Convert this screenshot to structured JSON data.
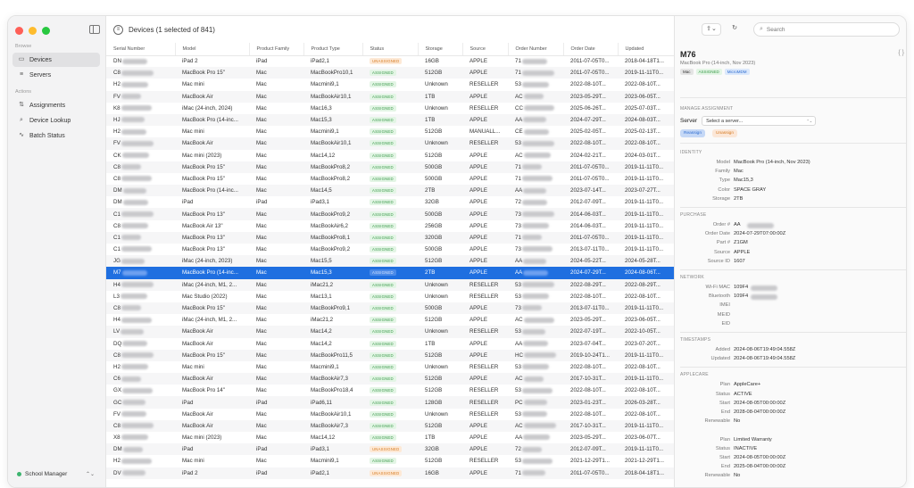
{
  "sidebar": {
    "browse_label": "Browse",
    "items_browse": [
      {
        "label": "Devices",
        "icon": "desktop-icon",
        "active": true
      },
      {
        "label": "Servers",
        "icon": "server-icon",
        "active": false
      }
    ],
    "actions_label": "Actions",
    "items_actions": [
      {
        "label": "Assignments",
        "icon": "sliders-icon"
      },
      {
        "label": "Device Lookup",
        "icon": "search-icon"
      },
      {
        "label": "Batch Status",
        "icon": "pulse-icon"
      }
    ],
    "org": "School Manager"
  },
  "toolbar": {
    "title": "Devices (1 selected of 841)"
  },
  "table": {
    "columns": [
      "Serial Number",
      "Model",
      "Product Family",
      "Product Type",
      "Status",
      "Storage",
      "Source",
      "Order Number",
      "Order Date",
      "Updated"
    ],
    "rows": [
      {
        "serial": "DN",
        "model": "iPad 2",
        "family": "iPad",
        "type": "iPad2,1",
        "status": "UNASSIGNED",
        "storage": "16GB",
        "source": "APPLE",
        "order": "71",
        "order_date": "2011-07-05T0...",
        "updated": "2018-04-18T1..."
      },
      {
        "serial": "C8",
        "model": "MacBook Pro 15\"",
        "family": "Mac",
        "type": "MacBookPro10,1",
        "status": "ASSIGNED",
        "storage": "512GB",
        "source": "APPLE",
        "order": "71",
        "order_date": "2011-07-05T0...",
        "updated": "2019-11-11T0..."
      },
      {
        "serial": "H2",
        "model": "Mac mini",
        "family": "Mac",
        "type": "Macmini9,1",
        "status": "ASSIGNED",
        "storage": "Unknown",
        "source": "RESELLER",
        "order": "53",
        "order_date": "2022-08-10T...",
        "updated": "2022-08-10T..."
      },
      {
        "serial": "FV",
        "model": "MacBook Air",
        "family": "Mac",
        "type": "MacBookAir10,1",
        "status": "ASSIGNED",
        "storage": "1TB",
        "source": "APPLE",
        "order": "AC",
        "order_date": "2023-05-29T...",
        "updated": "2023-06-05T..."
      },
      {
        "serial": "K8",
        "model": "iMac (24-inch, 2024)",
        "family": "Mac",
        "type": "Mac16,3",
        "status": "ASSIGNED",
        "storage": "Unknown",
        "source": "RESELLER",
        "order": "CC",
        "order_date": "2025-06-26T...",
        "updated": "2025-07-03T..."
      },
      {
        "serial": "HJ",
        "model": "MacBook Pro (14-inc...",
        "family": "Mac",
        "type": "Mac15,3",
        "status": "ASSIGNED",
        "storage": "1TB",
        "source": "APPLE",
        "order": "AA",
        "order_date": "2024-07-29T...",
        "updated": "2024-08-03T..."
      },
      {
        "serial": "H2",
        "model": "Mac mini",
        "family": "Mac",
        "type": "Macmini9,1",
        "status": "ASSIGNED",
        "storage": "512GB",
        "source": "MANUALL...",
        "order": "CE",
        "order_date": "2025-02-05T...",
        "updated": "2025-02-13T..."
      },
      {
        "serial": "FV",
        "model": "MacBook Air",
        "family": "Mac",
        "type": "MacBookAir10,1",
        "status": "ASSIGNED",
        "storage": "Unknown",
        "source": "RESELLER",
        "order": "53",
        "order_date": "2022-08-10T...",
        "updated": "2022-08-10T..."
      },
      {
        "serial": "CK",
        "model": "Mac mini (2023)",
        "family": "Mac",
        "type": "Mac14,12",
        "status": "ASSIGNED",
        "storage": "512GB",
        "source": "APPLE",
        "order": "AC",
        "order_date": "2024-02-21T...",
        "updated": "2024-03-01T..."
      },
      {
        "serial": "C8",
        "model": "MacBook Pro 15\"",
        "family": "Mac",
        "type": "MacBookPro8,2",
        "status": "ASSIGNED",
        "storage": "500GB",
        "source": "APPLE",
        "order": "71",
        "order_date": "2011-07-05T0...",
        "updated": "2019-11-11T0..."
      },
      {
        "serial": "C8",
        "model": "MacBook Pro 15\"",
        "family": "Mac",
        "type": "MacBookPro8,2",
        "status": "ASSIGNED",
        "storage": "500GB",
        "source": "APPLE",
        "order": "71",
        "order_date": "2011-07-05T0...",
        "updated": "2019-11-11T0..."
      },
      {
        "serial": "DM",
        "model": "MacBook Pro (14-inc...",
        "family": "Mac",
        "type": "Mac14,5",
        "status": "ASSIGNED",
        "storage": "2TB",
        "source": "APPLE",
        "order": "AA",
        "order_date": "2023-07-14T...",
        "updated": "2023-07-27T..."
      },
      {
        "serial": "DM",
        "model": "iPad",
        "family": "iPad",
        "type": "iPad3,1",
        "status": "ASSIGNED",
        "storage": "32GB",
        "source": "APPLE",
        "order": "72",
        "order_date": "2012-07-09T...",
        "updated": "2019-11-11T0..."
      },
      {
        "serial": "C1",
        "model": "MacBook Pro 13\"",
        "family": "Mac",
        "type": "MacBookPro9,2",
        "status": "ASSIGNED",
        "storage": "500GB",
        "source": "APPLE",
        "order": "73",
        "order_date": "2014-06-03T...",
        "updated": "2019-11-11T0..."
      },
      {
        "serial": "C8",
        "model": "MacBook Air 13\"",
        "family": "Mac",
        "type": "MacBookAir6,2",
        "status": "ASSIGNED",
        "storage": "256GB",
        "source": "APPLE",
        "order": "73",
        "order_date": "2014-06-03T...",
        "updated": "2019-11-11T0..."
      },
      {
        "serial": "C1",
        "model": "MacBook Pro 13\"",
        "family": "Mac",
        "type": "MacBookPro8,1",
        "status": "ASSIGNED",
        "storage": "320GB",
        "source": "APPLE",
        "order": "71",
        "order_date": "2011-07-05T0...",
        "updated": "2019-11-11T0..."
      },
      {
        "serial": "C1",
        "model": "MacBook Pro 13\"",
        "family": "Mac",
        "type": "MacBookPro9,2",
        "status": "ASSIGNED",
        "storage": "500GB",
        "source": "APPLE",
        "order": "73",
        "order_date": "2013-07-11T0...",
        "updated": "2019-11-11T0..."
      },
      {
        "serial": "JG",
        "model": "iMac (24-inch, 2023)",
        "family": "Mac",
        "type": "Mac15,5",
        "status": "ASSIGNED",
        "storage": "512GB",
        "source": "APPLE",
        "order": "AA",
        "order_date": "2024-05-22T...",
        "updated": "2024-05-28T..."
      },
      {
        "serial": "M7",
        "model": "MacBook Pro (14-inc...",
        "family": "Mac",
        "type": "Mac15,3",
        "status": "ASSIGNED",
        "storage": "2TB",
        "source": "APPLE",
        "order": "AA",
        "order_date": "2024-07-29T...",
        "updated": "2024-08-06T...",
        "selected": true
      },
      {
        "serial": "H4",
        "model": "iMac (24-inch, M1, 2...",
        "family": "Mac",
        "type": "iMac21,2",
        "status": "ASSIGNED",
        "storage": "Unknown",
        "source": "RESELLER",
        "order": "53",
        "order_date": "2022-08-29T...",
        "updated": "2022-08-29T..."
      },
      {
        "serial": "L3",
        "model": "Mac Studio (2022)",
        "family": "Mac",
        "type": "Mac13,1",
        "status": "ASSIGNED",
        "storage": "Unknown",
        "source": "RESELLER",
        "order": "53",
        "order_date": "2022-08-10T...",
        "updated": "2022-08-10T..."
      },
      {
        "serial": "C8",
        "model": "MacBook Pro 15\"",
        "family": "Mac",
        "type": "MacBookPro9,1",
        "status": "ASSIGNED",
        "storage": "500GB",
        "source": "APPLE",
        "order": "73",
        "order_date": "2013-07-11T0...",
        "updated": "2019-11-11T0..."
      },
      {
        "serial": "H4",
        "model": "iMac (24-inch, M1, 2...",
        "family": "Mac",
        "type": "iMac21,2",
        "status": "ASSIGNED",
        "storage": "512GB",
        "source": "APPLE",
        "order": "AC",
        "order_date": "2023-05-29T...",
        "updated": "2023-06-05T..."
      },
      {
        "serial": "LV",
        "model": "MacBook Air",
        "family": "Mac",
        "type": "Mac14,2",
        "status": "ASSIGNED",
        "storage": "Unknown",
        "source": "RESELLER",
        "order": "53",
        "order_date": "2022-07-19T...",
        "updated": "2022-10-05T..."
      },
      {
        "serial": "DQ",
        "model": "MacBook Air",
        "family": "Mac",
        "type": "Mac14,2",
        "status": "ASSIGNED",
        "storage": "1TB",
        "source": "APPLE",
        "order": "AA",
        "order_date": "2023-07-04T...",
        "updated": "2023-07-20T..."
      },
      {
        "serial": "C8",
        "model": "MacBook Pro 15\"",
        "family": "Mac",
        "type": "MacBookPro11,5",
        "status": "ASSIGNED",
        "storage": "512GB",
        "source": "APPLE",
        "order": "HC",
        "order_date": "2019-10-24T1...",
        "updated": "2019-11-11T0..."
      },
      {
        "serial": "H2",
        "model": "Mac mini",
        "family": "Mac",
        "type": "Macmini9,1",
        "status": "ASSIGNED",
        "storage": "Unknown",
        "source": "RESELLER",
        "order": "53",
        "order_date": "2022-08-10T...",
        "updated": "2022-08-10T..."
      },
      {
        "serial": "C6",
        "model": "MacBook Air",
        "family": "Mac",
        "type": "MacBookAir7,3",
        "status": "ASSIGNED",
        "storage": "512GB",
        "source": "APPLE",
        "order": "AC",
        "order_date": "2017-10-31T...",
        "updated": "2019-11-11T0..."
      },
      {
        "serial": "GX",
        "model": "MacBook Pro 14\"",
        "family": "Mac",
        "type": "MacBookPro18,4",
        "status": "ASSIGNED",
        "storage": "512GB",
        "source": "RESELLER",
        "order": "53",
        "order_date": "2022-08-10T...",
        "updated": "2022-08-10T..."
      },
      {
        "serial": "GC",
        "model": "iPad",
        "family": "iPad",
        "type": "iPad6,11",
        "status": "ASSIGNED",
        "storage": "128GB",
        "source": "RESELLER",
        "order": "PC",
        "order_date": "2023-01-23T...",
        "updated": "2026-03-28T..."
      },
      {
        "serial": "FV",
        "model": "MacBook Air",
        "family": "Mac",
        "type": "MacBookAir10,1",
        "status": "ASSIGNED",
        "storage": "Unknown",
        "source": "RESELLER",
        "order": "53",
        "order_date": "2022-08-10T...",
        "updated": "2022-08-10T..."
      },
      {
        "serial": "C8",
        "model": "MacBook Air",
        "family": "Mac",
        "type": "MacBookAir7,3",
        "status": "ASSIGNED",
        "storage": "512GB",
        "source": "APPLE",
        "order": "AC",
        "order_date": "2017-10-31T...",
        "updated": "2019-11-11T0..."
      },
      {
        "serial": "X8",
        "model": "Mac mini (2023)",
        "family": "Mac",
        "type": "Mac14,12",
        "status": "ASSIGNED",
        "storage": "1TB",
        "source": "APPLE",
        "order": "AA",
        "order_date": "2023-05-29T...",
        "updated": "2023-06-07T..."
      },
      {
        "serial": "DM",
        "model": "iPad",
        "family": "iPad",
        "type": "iPad3,1",
        "status": "UNASSIGNED",
        "storage": "32GB",
        "source": "APPLE",
        "order": "72",
        "order_date": "2012-07-09T...",
        "updated": "2019-11-11T0..."
      },
      {
        "serial": "H2",
        "model": "Mac mini",
        "family": "Mac",
        "type": "Macmini9,1",
        "status": "ASSIGNED",
        "storage": "512GB",
        "source": "RESELLER",
        "order": "53",
        "order_date": "2021-12-29T1...",
        "updated": "2021-12-29T1..."
      },
      {
        "serial": "DV",
        "model": "iPad 2",
        "family": "iPad",
        "type": "iPad2,1",
        "status": "UNASSIGNED",
        "storage": "16GB",
        "source": "APPLE",
        "order": "71",
        "order_date": "2011-07-05T0...",
        "updated": "2018-04-18T1..."
      }
    ]
  },
  "search": {
    "placeholder": "Search"
  },
  "detail": {
    "serial": "M76",
    "model": "MacBook Pro (14-inch, Nov 2023)",
    "tags": [
      "Mac",
      "ASSIGNED",
      "MicroMDM"
    ],
    "manage_label": "MANAGE ASSIGNMENT",
    "server_label": "Server",
    "server_placeholder": "Select a server...",
    "reassign": "Reassign",
    "unassign": "Unassign",
    "sections": [
      {
        "title": "IDENTITY",
        "rows": [
          {
            "k": "Model",
            "v": "MacBook Pro (14-inch, Nov 2023)"
          },
          {
            "k": "Family",
            "v": "Mac"
          },
          {
            "k": "Type",
            "v": "Mac15,3"
          },
          {
            "k": "Color",
            "v": "SPACE GRAY"
          },
          {
            "k": "Storage",
            "v": "2TB"
          }
        ]
      },
      {
        "title": "PURCHASE",
        "rows": [
          {
            "k": "Order #",
            "v": "AA"
          },
          {
            "k": "Order Date",
            "v": "2024-07-29T07:00:00Z"
          },
          {
            "k": "Part #",
            "v": "Z1GM"
          },
          {
            "k": "Source",
            "v": "APPLE"
          },
          {
            "k": "Source ID",
            "v": "1607"
          }
        ]
      },
      {
        "title": "NETWORK",
        "rows": [
          {
            "k": "Wi-Fi MAC",
            "v": "109F4"
          },
          {
            "k": "Bluetooth",
            "v": "109F4"
          },
          {
            "k": "IMEI",
            "v": ""
          },
          {
            "k": "MEID",
            "v": ""
          },
          {
            "k": "EID",
            "v": ""
          }
        ]
      },
      {
        "title": "TIMESTAMPS",
        "rows": [
          {
            "k": "Added",
            "v": "2024-08-06T19:49:04.558Z"
          },
          {
            "k": "Updated",
            "v": "2024-08-06T19:49:04.558Z"
          }
        ]
      },
      {
        "title": "APPLECARE",
        "rows": [
          {
            "k": "Plan",
            "v": "AppleCare+"
          },
          {
            "k": "Status",
            "v": "ACTIVE"
          },
          {
            "k": "Start",
            "v": "2024-08-05T00:00:00Z"
          },
          {
            "k": "End",
            "v": "2028-08-04T00:00:00Z"
          },
          {
            "k": "Renewable",
            "v": "No"
          },
          {
            "k": "",
            "v": ""
          },
          {
            "k": "Plan",
            "v": "Limited Warranty"
          },
          {
            "k": "Status",
            "v": "INACTIVE"
          },
          {
            "k": "Start",
            "v": "2024-08-05T00:00:00Z"
          },
          {
            "k": "End",
            "v": "2025-08-04T00:00:00Z"
          },
          {
            "k": "Renewable",
            "v": "No"
          }
        ]
      }
    ]
  },
  "colors": {
    "accent": "#1f6fe0",
    "assigned": "#3a9a4a",
    "unassigned": "#d67b22"
  }
}
